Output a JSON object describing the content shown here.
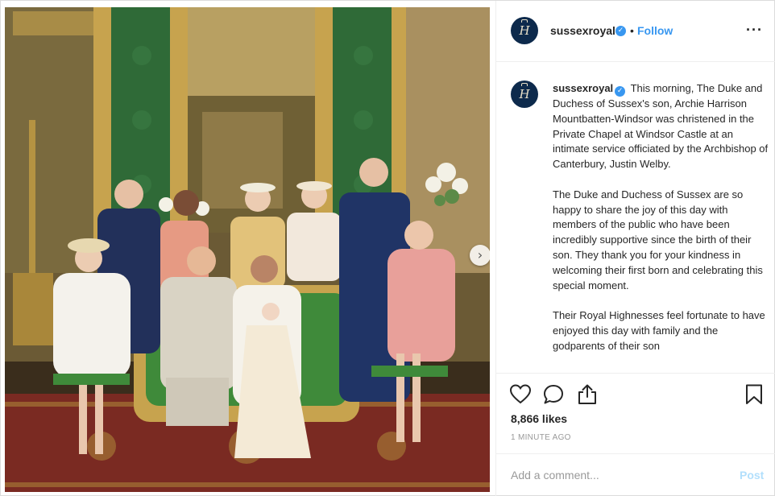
{
  "post": {
    "image_description_icon": "photo",
    "next_icon": "chevron-right-icon"
  },
  "header": {
    "username": "sussexroyal",
    "separator": "•",
    "follow_label": "Follow",
    "more_icon": "more-options-icon",
    "more_label": "···",
    "avatar_monogram": "H"
  },
  "caption": {
    "username": "sussexroyal",
    "paragraphs": [
      "This morning, The Duke and Duchess of Sussex's son, Archie Harrison Mountbatten-Windsor was christened in the Private Chapel at Windsor Castle at an intimate service officiated by the Archbishop of Canterbury, Justin Welby.",
      "The Duke and Duchess of Sussex are so happy to share the joy of this day with members of the public who have been incredibly supportive since the birth of their son. They thank you for your kindness in welcoming their first born and celebrating this special moment.",
      "Their Royal Highnesses feel fortunate to have enjoyed this day with family and the godparents of their son"
    ]
  },
  "actions": {
    "like_icon": "heart-icon",
    "comment_icon": "comment-icon",
    "share_icon": "share-icon",
    "save_icon": "bookmark-icon",
    "likes": "8,866 likes",
    "time": "1 MINUTE AGO"
  },
  "comment_box": {
    "placeholder": "Add a comment...",
    "post_label": "Post"
  },
  "colors": {
    "accent": "#3897f0",
    "post_disabled": "#b2dffc",
    "avatar_bg": "#0d2a4c"
  }
}
